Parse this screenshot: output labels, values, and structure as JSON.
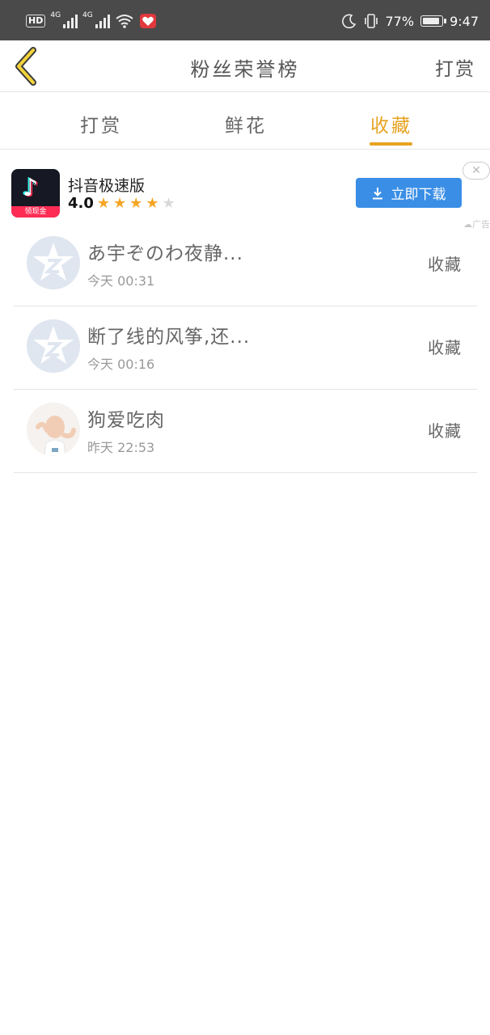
{
  "status_bar": {
    "network_left": "HD",
    "net1": "4G",
    "net2": "4G",
    "battery": "77%",
    "battery_level": 0.77,
    "time": "9:47",
    "icons": [
      "hd-icon",
      "signal-icon",
      "signal-icon",
      "wifi-icon",
      "app-notification-icon",
      "moon-icon",
      "vibrate-icon",
      "battery-icon"
    ]
  },
  "header": {
    "title": "粉丝荣誉榜",
    "right_label": "打赏",
    "back_icon": "chevron-left-icon"
  },
  "tabs": [
    {
      "label": "打赏",
      "active": false
    },
    {
      "label": "鲜花",
      "active": false
    },
    {
      "label": "收藏",
      "active": true
    }
  ],
  "ad": {
    "app_name": "抖音极速版",
    "rating": "4.0",
    "stars": 4,
    "badge": "领现金",
    "download_label": "立即下载",
    "tag": "广告",
    "close_icon": "close-icon"
  },
  "list": [
    {
      "name": "あ宇ぞのわ夜静...",
      "time": "今天 00:31",
      "action": "收藏",
      "avatar": "qzone-default-avatar"
    },
    {
      "name": "断了线的风筝,还...",
      "time": "今天 00:16",
      "action": "收藏",
      "avatar": "qzone-default-avatar"
    },
    {
      "name": "狗爱吃肉",
      "time": "昨天 22:53",
      "action": "收藏",
      "avatar": "baby-photo-avatar"
    }
  ],
  "colors": {
    "accent": "#e7a321",
    "status_bar": "#4a4a4a",
    "download": "#3a8ee6",
    "star": "#f5a623"
  }
}
